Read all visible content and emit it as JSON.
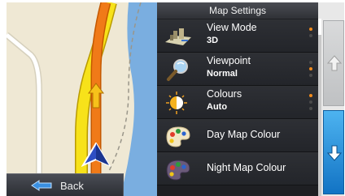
{
  "map": {
    "back_label": "Back"
  },
  "panel": {
    "title": "Map Settings",
    "items": [
      {
        "label": "View Mode",
        "value": "3D",
        "icon": "view-mode-icon"
      },
      {
        "label": "Viewpoint",
        "value": "Normal",
        "icon": "viewpoint-icon"
      },
      {
        "label": "Colours",
        "value": "Auto",
        "icon": "colours-icon"
      },
      {
        "label": "Day Map Colour",
        "icon": "day-palette-icon"
      },
      {
        "label": "Night Map Colour",
        "icon": "night-palette-icon"
      }
    ]
  },
  "colors": {
    "accent_orange": "#f08a1c",
    "inactive_dot": "#4a4a4a",
    "scroll_down_blue": "#1a82d0"
  }
}
